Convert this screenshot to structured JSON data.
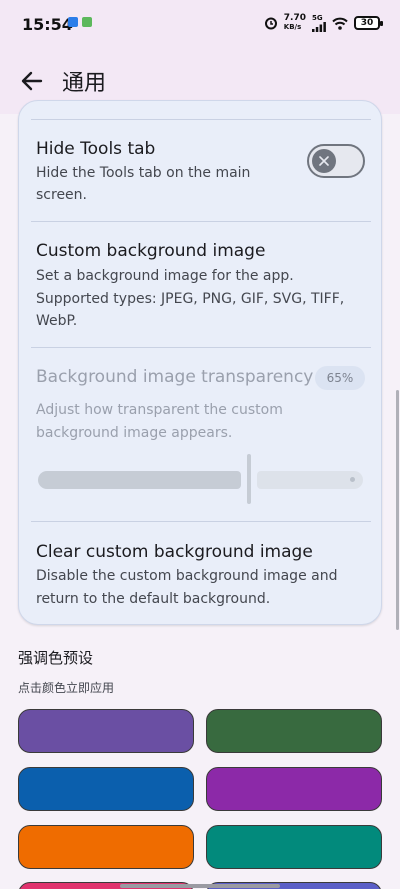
{
  "status_bar": {
    "time": "15:54",
    "net_speed_value": "7.70",
    "net_speed_unit": "KB/s",
    "network": "5G",
    "battery": "30"
  },
  "app_bar": {
    "title": "通用",
    "back_icon": "arrow-left-icon"
  },
  "settings": {
    "hide_tools": {
      "title": "Hide Tools tab",
      "desc_line1": "Hide the Tools tab on the main",
      "desc_line2": "screen.",
      "toggle_on": false
    },
    "custom_bg": {
      "title": "Custom background image",
      "desc_line1": "Set a background image for the app.",
      "desc_line2": "Supported types: JPEG, PNG, GIF, SVG, TIFF,",
      "desc_line3": "WebP."
    },
    "bg_transparency": {
      "title": "Background image transparency",
      "value": "65%",
      "level": 0.65,
      "desc_line1": "Adjust how transparent the custom",
      "desc_line2": "background image appears.",
      "enabled": false
    },
    "clear_bg": {
      "title": "Clear custom background image",
      "desc_line1": "Disable the custom background image and",
      "desc_line2": "return to the default background."
    }
  },
  "accent_presets": {
    "title": "强调色预设",
    "subtitle": "点击颜色立即应用",
    "colors": [
      "#6a4fa3",
      "#386a3f",
      "#0b5fad",
      "#8c29a8",
      "#ef6c00",
      "#028a7c",
      "#e0336e",
      "#5b5fc7"
    ]
  }
}
